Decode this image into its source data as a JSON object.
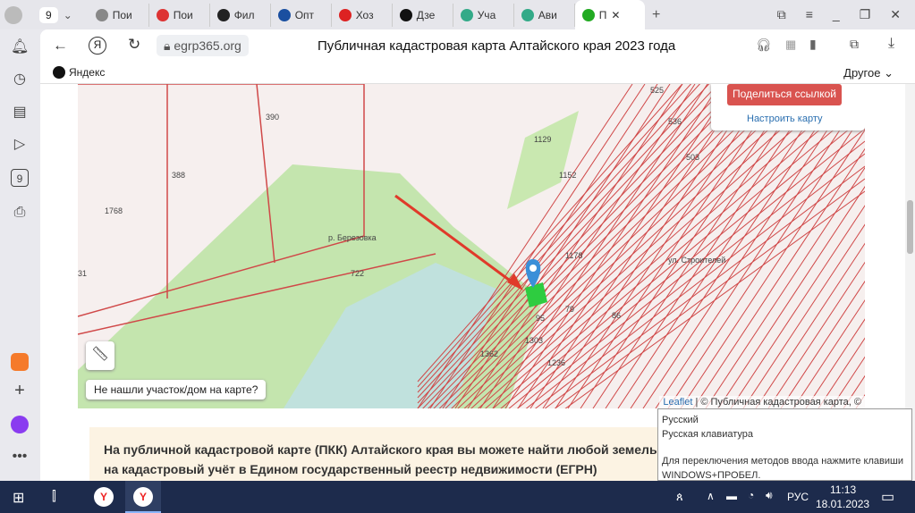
{
  "tabs": [
    {
      "label": "9",
      "type": "counter"
    },
    {
      "label": "Пои",
      "color": "#888"
    },
    {
      "label": "Пои",
      "color": "#d33"
    },
    {
      "label": "Фил",
      "color": "#222"
    },
    {
      "label": "Опт",
      "color": "#1a4fa0"
    },
    {
      "label": "Хоз",
      "color": "#d22"
    },
    {
      "label": "Дзе",
      "color": "#111"
    },
    {
      "label": "Уча",
      "color": "#3a8"
    },
    {
      "label": "Ави",
      "color": "#3a8"
    },
    {
      "label": "П",
      "color": "#2a2",
      "active": true
    }
  ],
  "address": {
    "url": "egrp365.org",
    "page_title": "Публичная кадастровая карта Алтайского края 2023 года"
  },
  "bookmarks": {
    "yandex": "Яндекс",
    "other": "Другое"
  },
  "map": {
    "share_button": "Поделиться ссылкой",
    "configure_link": "Настроить карту",
    "not_found_button": "Не нашли участок/дом на карте?",
    "attribution_leaflet": "Leaflet",
    "attribution_text": "| © Публичная кадастровая карта, ©",
    "labels": [
      "390",
      "388",
      "1768",
      "722",
      "31",
      "1129",
      "1236",
      "р. Березовка",
      "ул. Строителей",
      "95",
      "79",
      "86",
      "1303",
      "1362",
      "1152",
      "1178",
      "503",
      "536",
      "525"
    ],
    "colors": {
      "parcel": "#d04848",
      "forest": "#bfe3a6",
      "water": "#bfe0e8",
      "selected": "#2ecc40",
      "marker": "#3b8fd8",
      "arrow": "#e03a2a"
    }
  },
  "info_text": "На публичной кадастровой карте (ПКК) Алтайского края вы можете найти любой земельный участок, которые поставлены на кадастровый учёт в Едином государственный реестр недвижимости (ЕГРН)",
  "ime_tooltip": {
    "line1": "Русский",
    "line2": "Русская клавиатура",
    "line3": "Для переключения методов ввода нажмите клавиши WINDOWS+ПРОБЕЛ."
  },
  "taskbar": {
    "lang": "РУС",
    "time": "11:13",
    "date": "18.01.2023"
  }
}
